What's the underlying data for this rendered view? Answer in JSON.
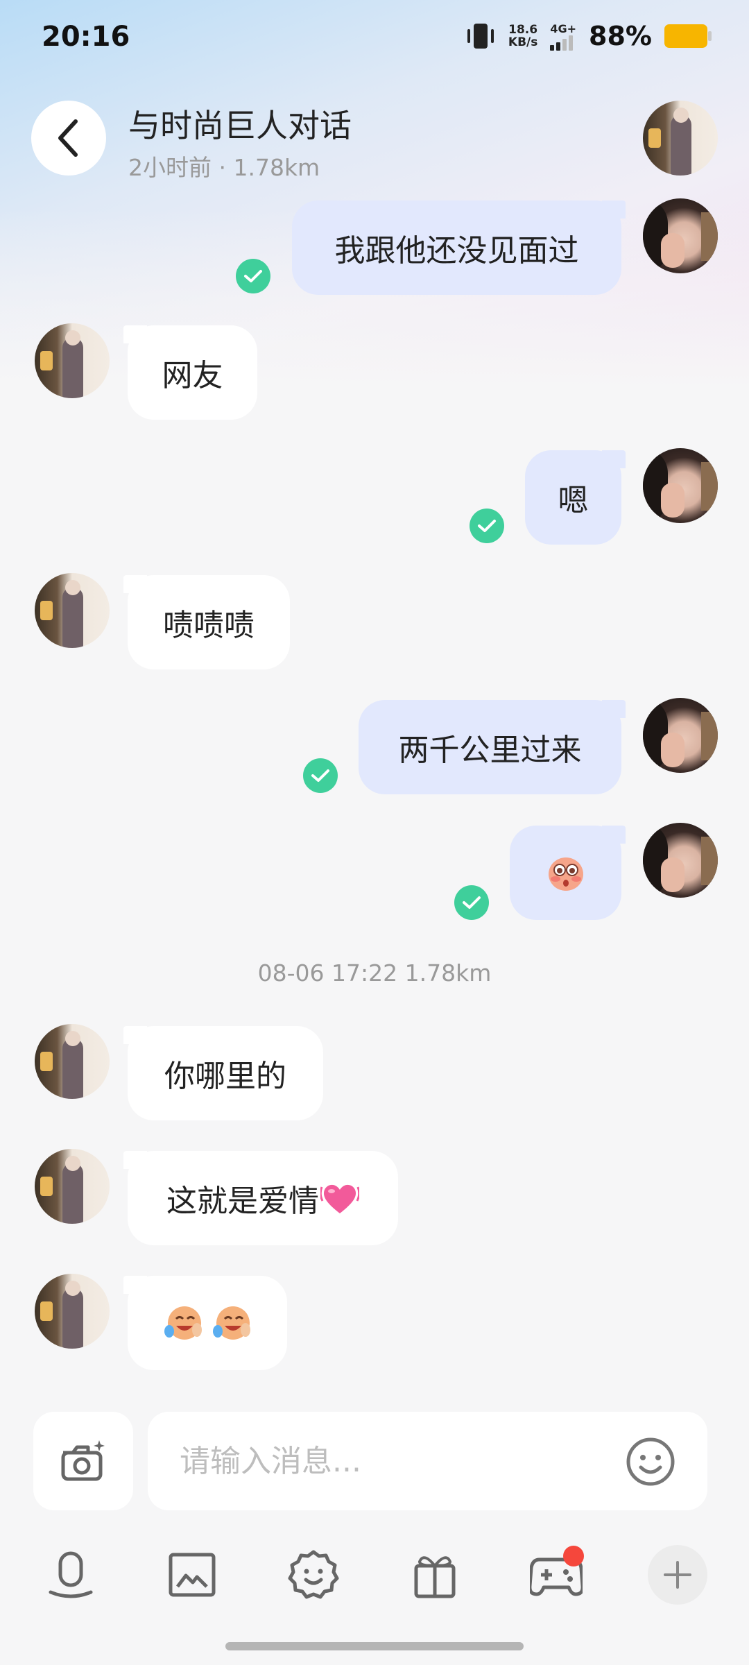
{
  "status_bar": {
    "time": "20:16",
    "speed_value": "18.6",
    "speed_unit": "KB/s",
    "network": "4G+",
    "battery_pct": "88%",
    "battery_color": "#f7b500"
  },
  "header": {
    "title": "与时尚巨人对话",
    "subtitle": "2小时前 · 1.78km"
  },
  "messages": [
    {
      "side": "out",
      "text": "我跟他还没见面过",
      "read": true
    },
    {
      "side": "in",
      "text": "网友"
    },
    {
      "side": "out",
      "text": "嗯",
      "read": true
    },
    {
      "side": "in",
      "text": "啧啧啧"
    },
    {
      "side": "out",
      "text": "两千公里过来",
      "read": true
    },
    {
      "side": "out",
      "text": "",
      "emoji": "blushing-face-sticker",
      "read": true
    },
    {
      "side": "in",
      "text": "你哪里的"
    },
    {
      "side": "in",
      "text": "这就是爱情",
      "emoji": "pink-heart"
    },
    {
      "side": "in",
      "text": "",
      "emoji": "laughing-crying-faces"
    }
  ],
  "timestamp": "08-06 17:22  1.78km",
  "composer": {
    "placeholder": "请输入消息..."
  },
  "toolbar": {
    "icons": [
      "mic-icon",
      "image-icon",
      "sticker-icon",
      "gift-icon",
      "game-icon",
      "plus-icon"
    ],
    "game_has_notification": true
  },
  "colors": {
    "outgoing_bubble": "#e2e8fd",
    "incoming_bubble": "#ffffff",
    "read_check": "#3fcf9b",
    "notification_dot": "#f5473c"
  }
}
